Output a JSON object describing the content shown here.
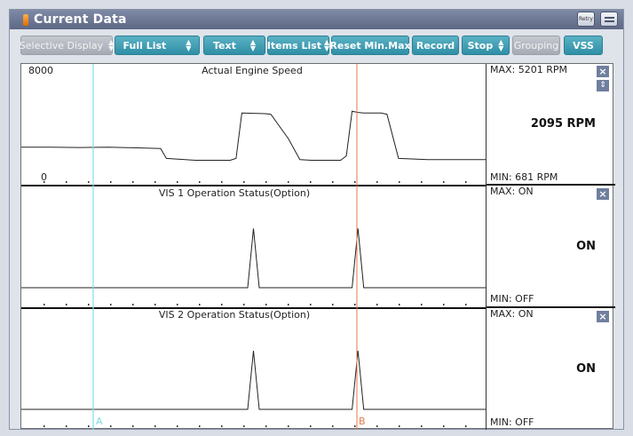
{
  "window": {
    "title": "Current Data",
    "retry_label": "Retry"
  },
  "toolbar": {
    "selective_display": "Selective Display",
    "full_list": "Full List",
    "text": "Text",
    "items_list": "Items List",
    "reset_min_max": "Reset Min.Max",
    "record": "Record",
    "stop": "Stop",
    "grouping": "Grouping",
    "vss": "VSS"
  },
  "cursors": {
    "a_label": "A",
    "b_label": "B",
    "a_color": "#7fe0e6",
    "b_color": "#e07b4a"
  },
  "charts": [
    {
      "title": "Actual Engine Speed",
      "y_max_label": "8000",
      "y_min_label": "0",
      "max_text": "MAX:  5201 RPM",
      "min_text": "MIN:   681 RPM",
      "current": "2095 RPM"
    },
    {
      "title": "VIS 1 Operation Status(Option)",
      "max_text": "MAX: ON",
      "min_text": "MIN: OFF",
      "current": "ON"
    },
    {
      "title": "VIS 2 Operation Status(Option)",
      "max_text": "MAX: ON",
      "min_text": "MIN: OFF",
      "current": "ON"
    }
  ],
  "chart_data": [
    {
      "type": "line",
      "title": "Actual Engine Speed",
      "x": [
        0,
        5,
        10,
        15,
        20,
        24,
        25,
        30,
        36,
        37,
        38,
        42,
        43,
        46,
        48,
        50,
        55,
        56,
        57,
        58,
        59,
        62,
        63,
        65,
        70,
        80
      ],
      "values": [
        2300,
        2300,
        2280,
        2300,
        2250,
        2200,
        1400,
        1250,
        1250,
        1400,
        5050,
        5000,
        4950,
        3000,
        1300,
        1250,
        1250,
        1600,
        5201,
        5100,
        5050,
        5050,
        4950,
        1400,
        1300,
        1300
      ],
      "ylim": [
        0,
        8000
      ],
      "unit": "RPM"
    },
    {
      "type": "line",
      "title": "VIS 1 Operation Status(Option)",
      "x": [
        0,
        39,
        40,
        41,
        57,
        58,
        59,
        80
      ],
      "values": [
        0,
        0,
        1,
        0,
        0,
        1,
        0,
        0
      ],
      "ylim": [
        0,
        1.5
      ]
    },
    {
      "type": "line",
      "title": "VIS 2 Operation Status(Option)",
      "x": [
        0,
        39,
        40,
        41,
        57,
        58,
        59,
        80
      ],
      "values": [
        0,
        0,
        1,
        0,
        0,
        1,
        0,
        0
      ],
      "ylim": [
        0,
        1.5
      ]
    }
  ]
}
